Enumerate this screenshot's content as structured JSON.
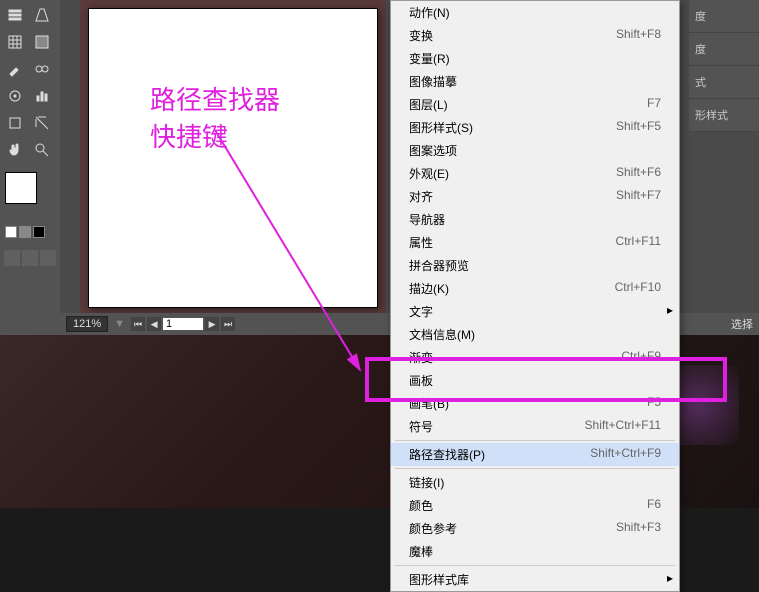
{
  "annotation": {
    "line1": "路径查找器",
    "line2": "快捷键"
  },
  "status": {
    "zoom": "121%",
    "page": "1",
    "select_text": "选择"
  },
  "panels": {
    "p1": "度",
    "p2": "度",
    "p3": "式",
    "p4": "形样式"
  },
  "menu": {
    "items": [
      {
        "label": "动作(N)",
        "shortcut": "",
        "type": "item"
      },
      {
        "label": "变换",
        "shortcut": "Shift+F8",
        "type": "item"
      },
      {
        "label": "变量(R)",
        "shortcut": "",
        "type": "item"
      },
      {
        "label": "图像描摹",
        "shortcut": "",
        "type": "item"
      },
      {
        "label": "图层(L)",
        "shortcut": "F7",
        "type": "item"
      },
      {
        "label": "图形样式(S)",
        "shortcut": "Shift+F5",
        "type": "item"
      },
      {
        "label": "图案选项",
        "shortcut": "",
        "type": "item"
      },
      {
        "label": "外观(E)",
        "shortcut": "Shift+F6",
        "type": "item"
      },
      {
        "label": "对齐",
        "shortcut": "Shift+F7",
        "type": "item"
      },
      {
        "label": "导航器",
        "shortcut": "",
        "type": "item"
      },
      {
        "label": "属性",
        "shortcut": "Ctrl+F11",
        "type": "item"
      },
      {
        "label": "拼合器预览",
        "shortcut": "",
        "type": "item"
      },
      {
        "label": "描边(K)",
        "shortcut": "Ctrl+F10",
        "type": "item"
      },
      {
        "label": "文字",
        "shortcut": "",
        "type": "submenu"
      },
      {
        "label": "文档信息(M)",
        "shortcut": "",
        "type": "item"
      },
      {
        "label": "渐变",
        "shortcut": "Ctrl+F9",
        "type": "item"
      },
      {
        "label": "画板",
        "shortcut": "",
        "type": "item"
      },
      {
        "label": "画笔(B)",
        "shortcut": "F5",
        "type": "item"
      },
      {
        "label": "符号",
        "shortcut": "Shift+Ctrl+F11",
        "type": "item"
      },
      {
        "type": "sep"
      },
      {
        "label": "路径查找器(P)",
        "shortcut": "Shift+Ctrl+F9",
        "type": "item",
        "highlighted": true
      },
      {
        "type": "sep"
      },
      {
        "label": "链接(I)",
        "shortcut": "",
        "type": "item"
      },
      {
        "label": "颜色",
        "shortcut": "F6",
        "type": "item"
      },
      {
        "label": "颜色参考",
        "shortcut": "Shift+F3",
        "type": "item"
      },
      {
        "label": "魔棒",
        "shortcut": "",
        "type": "item"
      },
      {
        "type": "sep"
      },
      {
        "label": "图形样式库",
        "shortcut": "",
        "type": "submenu"
      }
    ]
  }
}
